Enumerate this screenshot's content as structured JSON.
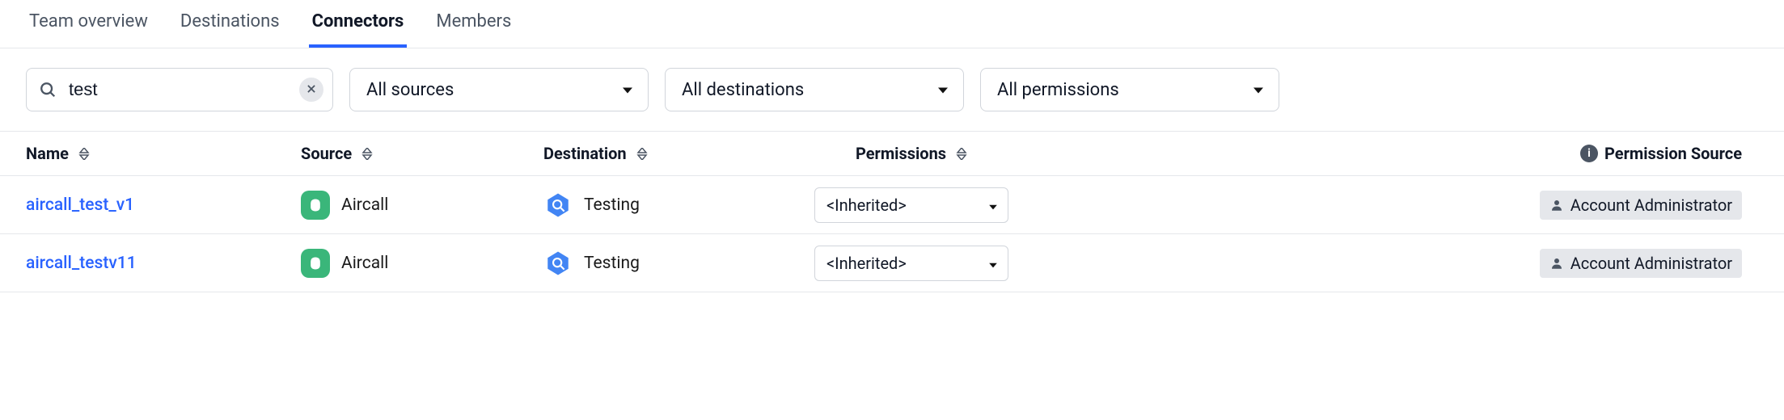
{
  "tabs": {
    "team_overview": "Team overview",
    "destinations": "Destinations",
    "connectors": "Connectors",
    "members": "Members",
    "active": "connectors"
  },
  "filters": {
    "search": {
      "value": "test",
      "placeholder": ""
    },
    "sources": {
      "label": "All sources"
    },
    "destinations": {
      "label": "All destinations"
    },
    "permissions": {
      "label": "All permissions"
    }
  },
  "table": {
    "headers": {
      "name": "Name",
      "source": "Source",
      "destination": "Destination",
      "permissions": "Permissions",
      "permission_source": "Permission Source"
    },
    "rows": [
      {
        "name": "aircall_test_v1",
        "source": "Aircall",
        "destination": "Testing",
        "permission": "<Inherited>",
        "permission_source": "Account Administrator"
      },
      {
        "name": "aircall_testv11",
        "source": "Aircall",
        "destination": "Testing",
        "permission": "<Inherited>",
        "permission_source": "Account Administrator"
      }
    ]
  }
}
